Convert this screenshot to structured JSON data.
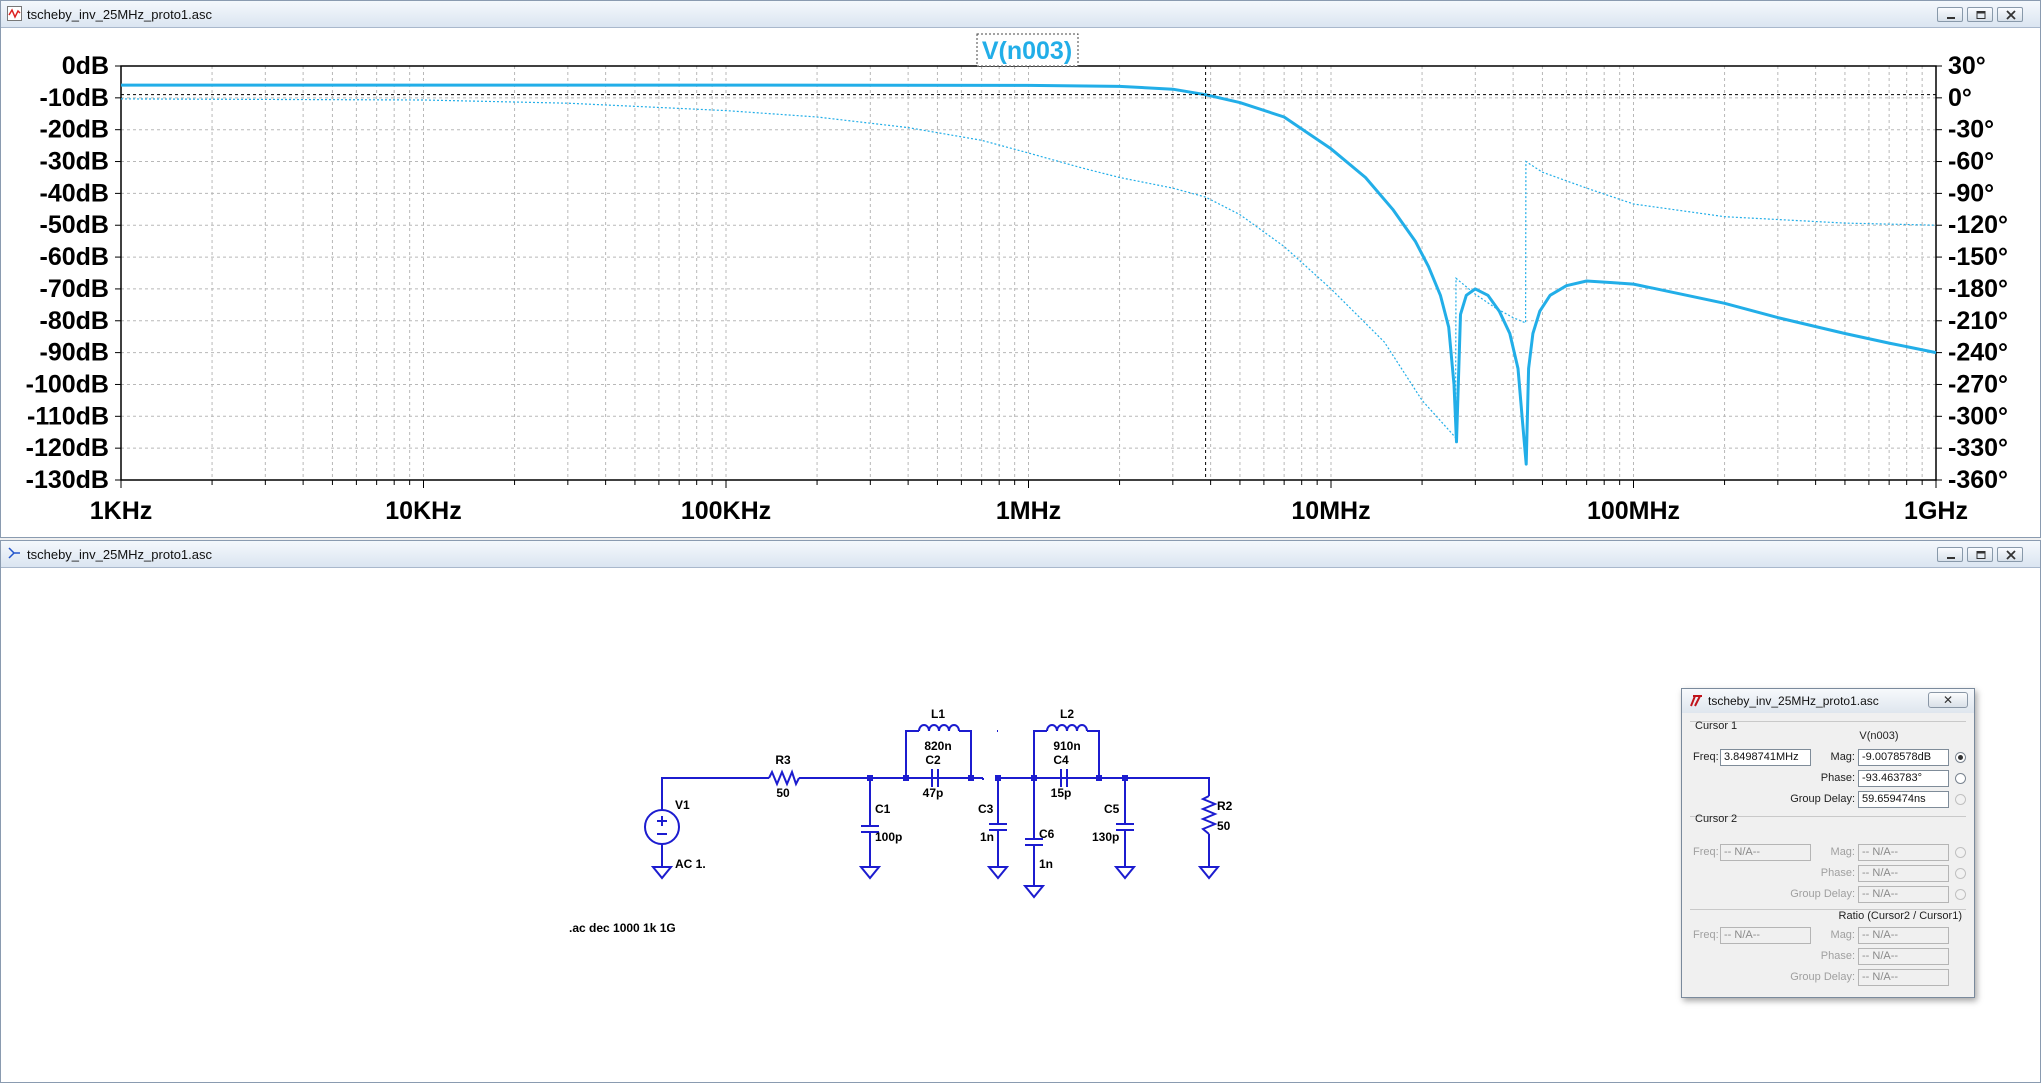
{
  "plot_window": {
    "title": "tscheby_inv_25MHz_proto1.asc",
    "trace_label": "V(n003)"
  },
  "schematic_window": {
    "title": "tscheby_inv_25MHz_proto1.asc",
    "spice_directive": ".ac dec 1000 1k 1G",
    "components": {
      "V1": {
        "name": "V1",
        "value": "AC 1."
      },
      "R3": {
        "name": "R3",
        "value": "50"
      },
      "L1": {
        "name": "L1",
        "value": "820n"
      },
      "C2": {
        "name": "C2",
        "value": "47p"
      },
      "L2": {
        "name": "L2",
        "value": "910n"
      },
      "C4": {
        "name": "C4",
        "value": "15p"
      },
      "C1": {
        "name": "C1",
        "value": "100p"
      },
      "C3": {
        "name": "C3",
        "value": "1n"
      },
      "C6": {
        "name": "C6",
        "value": "1n"
      },
      "C5": {
        "name": "C5",
        "value": "130p"
      },
      "R2": {
        "name": "R2",
        "value": "50"
      }
    }
  },
  "cursor_dialog": {
    "title": "tscheby_inv_25MHz_proto1.asc",
    "close_label": "✕",
    "cursor1": {
      "group_label": "Cursor 1",
      "trace": "V(n003)",
      "freq_label": "Freq:",
      "freq": "3.8498741MHz",
      "mag_label": "Mag:",
      "mag": "-9.0078578dB",
      "phase_label": "Phase:",
      "phase": "-93.463783°",
      "gd_label": "Group Delay:",
      "gd": "59.659474ns"
    },
    "cursor2": {
      "group_label": "Cursor 2",
      "freq_label": "Freq:",
      "freq": "-- N/A--",
      "mag_label": "Mag:",
      "mag": "-- N/A--",
      "phase_label": "Phase:",
      "phase": "-- N/A--",
      "gd_label": "Group Delay:",
      "gd": "-- N/A--"
    },
    "ratio": {
      "group_label": "Ratio (Cursor2 / Cursor1)",
      "freq_label": "Freq:",
      "freq": "-- N/A--",
      "mag_label": "Mag:",
      "mag": "-- N/A--",
      "phase_label": "Phase:",
      "phase": "-- N/A--",
      "gd_label": "Group Delay:",
      "gd": "-- N/A--"
    }
  },
  "colors": {
    "trace": "#22aee8",
    "schematic_wire": "#1c1ccf",
    "grid": "#b8b8b8"
  },
  "chart_data": {
    "type": "line",
    "title": "V(n003)",
    "x_scale": "log",
    "xlim_hz": [
      1000,
      1000000000
    ],
    "x_tick_labels": [
      "1KHz",
      "10KHz",
      "100KHz",
      "1MHz",
      "10MHz",
      "100MHz",
      "1GHz"
    ],
    "y_left_ticks": [
      "0dB",
      "-10dB",
      "-20dB",
      "-30dB",
      "-40dB",
      "-50dB",
      "-60dB",
      "-70dB",
      "-80dB",
      "-90dB",
      "-100dB",
      "-110dB",
      "-120dB",
      "-130dB"
    ],
    "y_right_ticks": [
      "30°",
      "0°",
      "-30°",
      "-60°",
      "-90°",
      "-120°",
      "-150°",
      "-180°",
      "-210°",
      "-240°",
      "-270°",
      "-300°",
      "-330°",
      "-360°"
    ],
    "ylim_db": [
      -130,
      0
    ],
    "ylim_deg": [
      -360,
      30
    ],
    "grid": true,
    "cursor": {
      "freq_hz": 3849874.1,
      "mag_db": -9.0078578
    },
    "series": [
      {
        "style": "solid",
        "unit": "dB",
        "x": [
          1000,
          100000,
          1000000,
          2000000,
          3000000,
          3849874,
          5000000,
          7000000,
          10000000,
          13000000,
          16000000,
          19000000,
          21000000,
          23000000,
          24500000,
          25500000,
          26000000,
          26800000,
          28000000,
          30000000,
          33000000,
          36000000,
          39000000,
          41500000,
          43000000,
          44200000,
          45000000,
          46500000,
          49000000,
          53000000,
          60000000,
          70000000,
          85000000,
          100000000,
          150000000,
          200000000,
          300000000,
          500000000,
          700000000,
          1000000000
        ],
        "y": [
          -6,
          -6,
          -6.1,
          -6.4,
          -7.3,
          -9.0,
          -11.5,
          -16,
          -26,
          -35,
          -45,
          -55,
          -63,
          -72,
          -82,
          -100,
          -118,
          -78,
          -72,
          -70,
          -72,
          -77,
          -84,
          -95,
          -112,
          -125,
          -95,
          -84,
          -77,
          -72,
          -69,
          -67.5,
          -68,
          -68.5,
          -72,
          -74.5,
          -79,
          -84,
          -87,
          -90
        ]
      },
      {
        "style": "dotted",
        "unit": "degrees",
        "x": [
          1000,
          10000,
          30000,
          100000,
          200000,
          400000,
          700000,
          1000000,
          1500000,
          2000000,
          3000000,
          3849874,
          5000000,
          7000000,
          10000000,
          15000000,
          20000000,
          25800000,
          25900000,
          30000000,
          35000000,
          40000000,
          44000000,
          44100000,
          50000000,
          70000000,
          100000000,
          200000000,
          500000000,
          1000000000
        ],
        "y": [
          -1,
          -2,
          -5,
          -12,
          -18,
          -28,
          -40,
          -52,
          -66,
          -75,
          -85,
          -93.5,
          -110,
          -140,
          -180,
          -230,
          -285,
          -320,
          -170,
          -185,
          -198,
          -207,
          -212,
          -60,
          -70,
          -85,
          -100,
          -112,
          -118,
          -120
        ]
      }
    ]
  }
}
